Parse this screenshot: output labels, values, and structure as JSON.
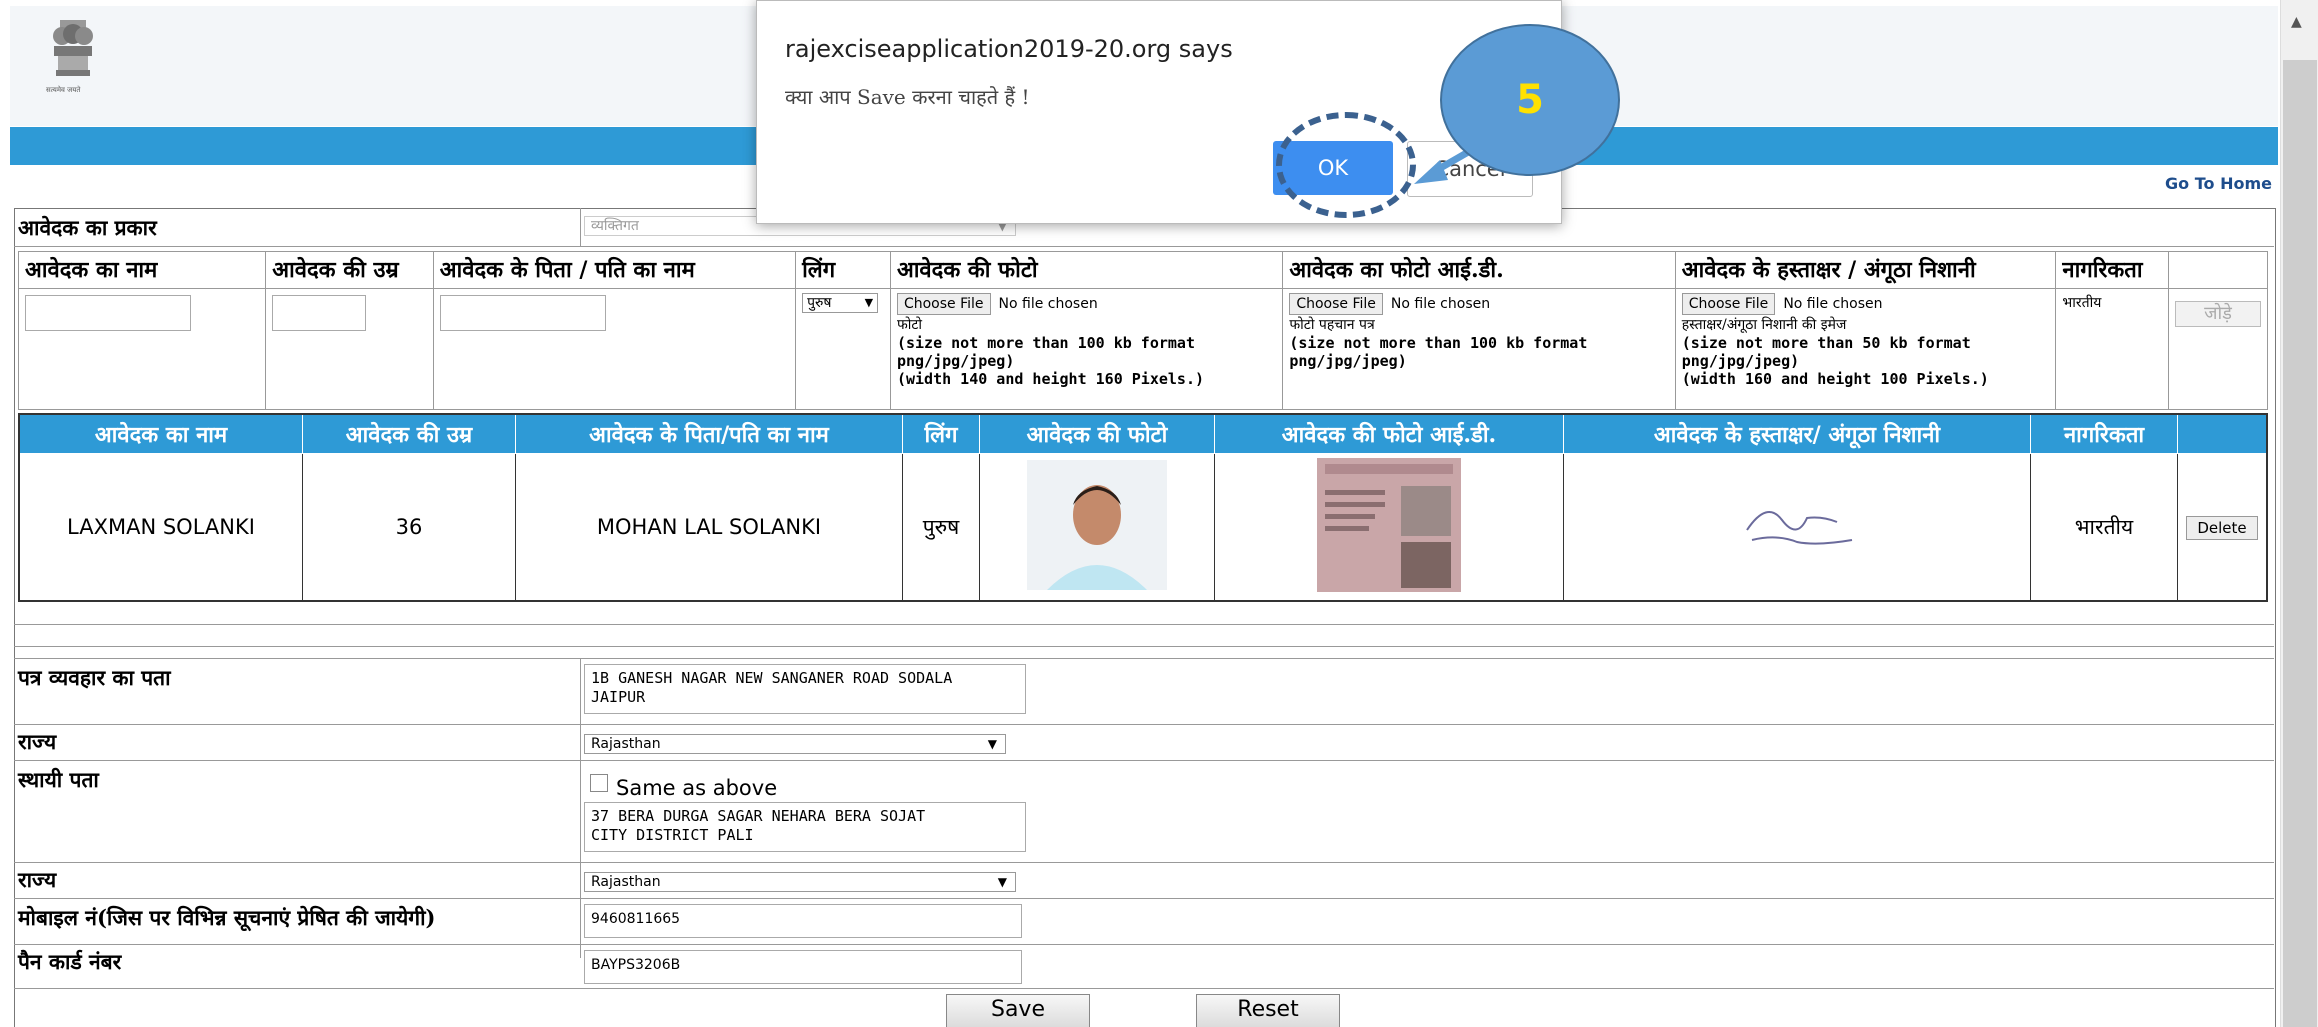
{
  "header": {
    "emblem_caption": "सत्यमेव जयते",
    "go_home": "Go To Home"
  },
  "form": {
    "applicant_type": {
      "label": "आवेदक का प्रकार",
      "value": "व्यक्तिगत"
    },
    "cols": {
      "name": "आवेदक का नाम",
      "age": "आवेदक की उम्र",
      "father": "आवेदक के पिता / पति का नाम",
      "gender": "लिंग",
      "photo": "आवेदक की फोटो",
      "photo_id": "आवेदक का फोटो आई.डी.",
      "signature": "आवेदक के हस्ताक्षर / अंगूठा निशानी",
      "citizenship": "नागरिकता"
    },
    "gender_value": "पुरुष",
    "choose_file": "Choose File",
    "no_file": "No file chosen",
    "photo_note_h": "फोटो",
    "photo_note": "(size not more than 100 kb format png/jpg/jpeg)\n(width 140 and height 160 Pixels.)",
    "photoid_note_h": "फोटो पहचान पत्र",
    "photoid_note": "(size not more than 100 kb format png/jpg/jpeg)",
    "sig_note_h": "हस्ताक्षर/अंगूठा निशानी की इमेज",
    "sig_note": "(size not more than 50 kb format png/jpg/jpeg)\n(width 160 and height 100 Pixels.)",
    "citizenship_value": "भारतीय",
    "add_button": "जोड़े"
  },
  "applicants_table": {
    "headers": [
      "आवेदक का नाम",
      "आवेदक की उम्र",
      "आवेदक के पिता/पति का नाम",
      "लिंग",
      "आवेदक की फोटो",
      "आवेदक की फोटो आई.डी.",
      "आवेदक के हस्ताक्षर/ अंगूठा निशानी",
      "नागरिकता",
      ""
    ],
    "row": {
      "name": "LAXMAN SOLANKI",
      "age": "36",
      "father": "MOHAN LAL SOLANKI",
      "gender": "पुरुष",
      "citizenship": "भारतीय",
      "delete": "Delete"
    }
  },
  "address": {
    "corr_label": "पत्र व्यवहार का पता",
    "corr_value": "1B GANESH NAGAR NEW SANGANER ROAD SODALA\nJAIPUR",
    "state_label": "राज्य",
    "state_value": "Rajasthan",
    "perm_label": "स्थायी पता",
    "same_as_above": "Same as above",
    "perm_value": "37 BERA DURGA SAGAR NEHARA BERA SOJAT\nCITY DISTRICT PALI",
    "state2_label": "राज्य",
    "state2_value": "Rajasthan",
    "mobile_label": "मोबाइल नं(जिस पर विभिन्न सूचनाएं प्रेषित की जायेगी)",
    "mobile_value": "9460811665",
    "pan_label": "पैन कार्ड नंबर",
    "pan_value": "BAYPS3206B"
  },
  "actions": {
    "save": "Save",
    "reset": "Reset"
  },
  "dialog": {
    "title": "rajexciseapplication2019-20.org says",
    "message": "क्या आप Save करना चाहते हैं !",
    "ok": "OK",
    "cancel": "Cancel"
  },
  "callout": {
    "step": "5"
  },
  "colors": {
    "accent": "#2e9ad6",
    "ok": "#3d8ef0",
    "callout": "#5b9bd5"
  }
}
